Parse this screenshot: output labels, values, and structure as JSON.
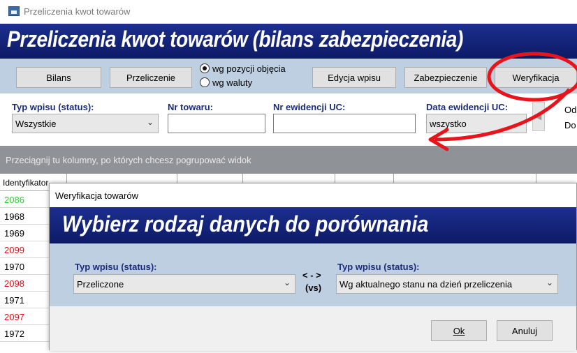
{
  "window": {
    "title": "Przeliczenia kwot towarów",
    "banner_title": "Przeliczenia kwot towarów (bilans zabezpieczenia)"
  },
  "toolbar": {
    "bilans": "Bilans",
    "przeliczenie": "Przeliczenie",
    "radio_option_1": "wg pozycji objęcia",
    "radio_option_2": "wg waluty",
    "edycja_wpisu": "Edycja wpisu",
    "zabezpieczenie": "Zabezpieczenie",
    "weryfikacja": "Weryfikacja"
  },
  "filters": {
    "typ_wpisu_label": "Typ wpisu (status):",
    "typ_wpisu_value": "Wszystkie",
    "nr_towaru_label": "Nr towaru:",
    "nr_towaru_value": "",
    "nr_ewidencji_label": "Nr ewidencji UC:",
    "nr_ewidencji_value": "",
    "data_ewidencji_label": "Data ewidencji UC:",
    "data_ewidencji_value": "wszystko",
    "od_label": "Od",
    "do_label": "Do"
  },
  "grid": {
    "group_panel_text": "Przeciągnij tu kolumny, po których chcesz pogrupować widok",
    "first_column_header": "Identyfikator",
    "rows": [
      {
        "id": "2086",
        "color": "#33cc33"
      },
      {
        "id": "1968",
        "color": "#000000"
      },
      {
        "id": "1969",
        "color": "#000000"
      },
      {
        "id": "2099",
        "color": "#e01010"
      },
      {
        "id": "1970",
        "color": "#000000"
      },
      {
        "id": "2098",
        "color": "#e01010"
      },
      {
        "id": "1971",
        "color": "#000000"
      },
      {
        "id": "2097",
        "color": "#e01010"
      },
      {
        "id": "1972",
        "color": "#000000"
      }
    ]
  },
  "dialog": {
    "title": "Weryfikacja towarów",
    "heading": "Wybierz rodzaj danych do porównania",
    "left_label": "Typ wpisu (status):",
    "left_value": "Przeliczone",
    "vs_arrow": "< - >",
    "vs_text": "(vs)",
    "right_label": "Typ wpisu (status):",
    "right_value": "Wg aktualnego stanu na dzień przeliczenia",
    "ok": "Ok",
    "cancel": "Anuluj"
  },
  "colors": {
    "banner": "#12237a",
    "panel": "#bfcfe2",
    "annotation": "#e8141c",
    "label": "#1a2a7a"
  }
}
